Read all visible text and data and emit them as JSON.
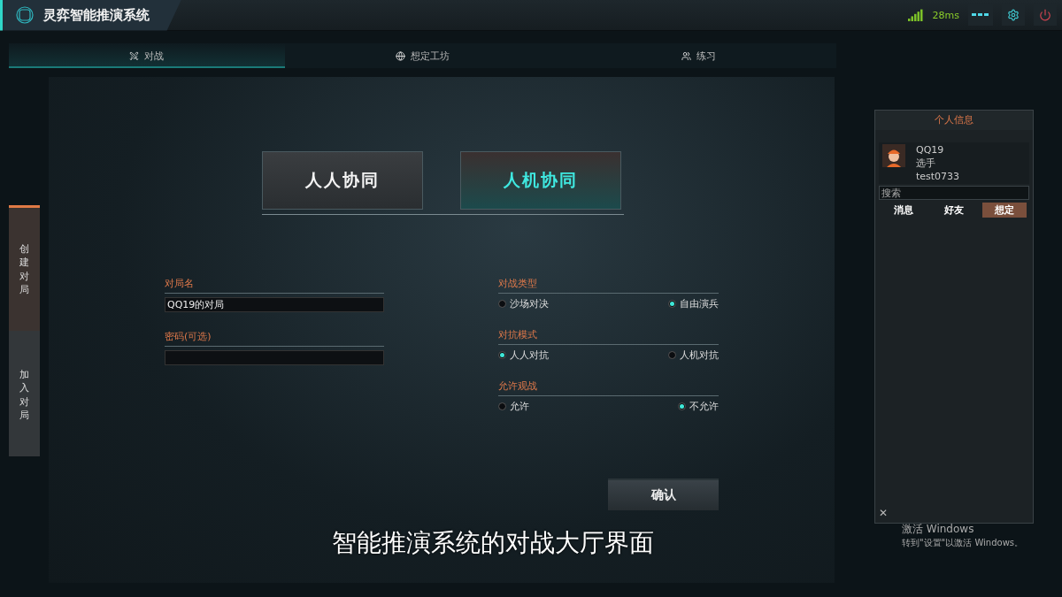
{
  "header": {
    "title": "灵弈智能推演系统",
    "ping": "28ms"
  },
  "nav": [
    {
      "label": "对战",
      "selected": true
    },
    {
      "label": "想定工坊",
      "selected": false
    },
    {
      "label": "练习",
      "selected": false
    }
  ],
  "side_tabs": [
    {
      "label": "创建对局",
      "selected": true
    },
    {
      "label": "加入对局",
      "selected": false
    }
  ],
  "modes": [
    {
      "label": "人人协同",
      "selected": false
    },
    {
      "label": "人机协同",
      "selected": true
    }
  ],
  "fields": [
    {
      "label": "对局名",
      "value": "QQ19的对局"
    },
    {
      "label": "密码(可选)"
    }
  ],
  "options": [
    {
      "label": "对战类型",
      "choices": [
        {
          "label": "沙场对决",
          "selected": false
        },
        {
          "label": "自由演兵",
          "selected": true
        }
      ]
    },
    {
      "label": "对抗模式",
      "choices": [
        {
          "label": "人人对抗",
          "selected": true
        },
        {
          "label": "人机对抗",
          "selected": false
        }
      ]
    },
    {
      "label": "允许观战",
      "choices": [
        {
          "label": "允许",
          "selected": false
        },
        {
          "label": "不允许",
          "selected": true
        }
      ]
    }
  ],
  "confirm": "确认",
  "subtitle": "智能推演系统的对战大厅界面",
  "profile": {
    "title": "个人信息",
    "name": "QQ19",
    "role": "选手",
    "account": "test0733",
    "search_placeholder": "搜索",
    "tabs": [
      {
        "label": "消息",
        "selected": false
      },
      {
        "label": "好友",
        "selected": false
      },
      {
        "label": "想定",
        "selected": true
      }
    ],
    "close": "✕"
  },
  "os_notice": {
    "title": "激活 Windows",
    "text": "转到\"设置\"以激活 Windows。"
  }
}
